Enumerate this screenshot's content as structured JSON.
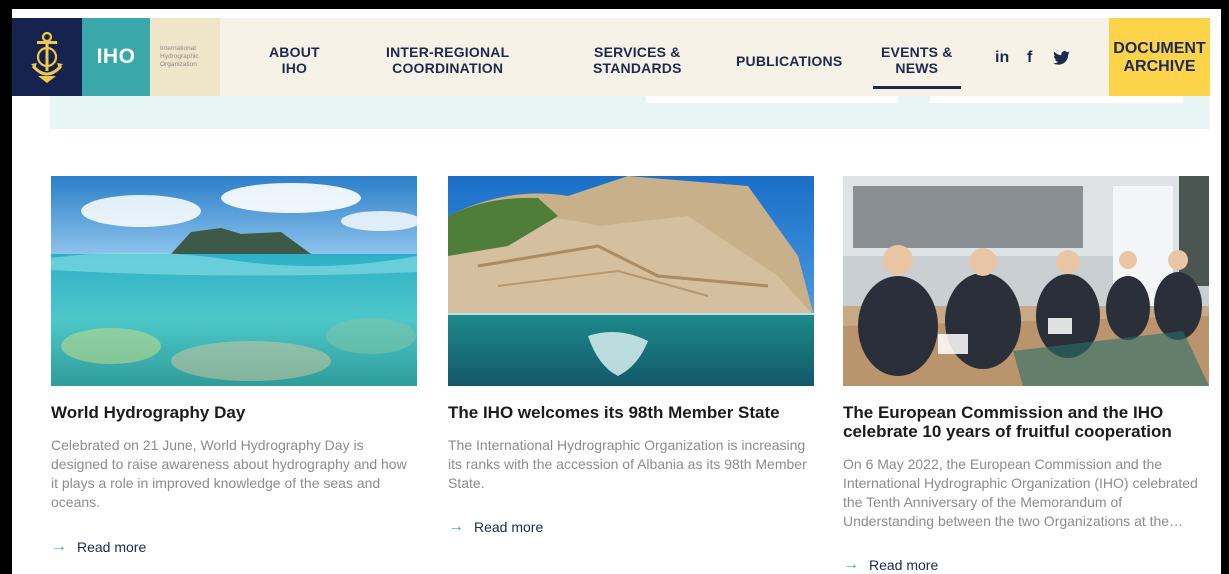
{
  "nav": {
    "logo_short": "IHO",
    "logo_full": "International Hydrographic Organization",
    "items": [
      {
        "line1": "ABOUT",
        "line2": "IHO"
      },
      {
        "line1": "INTER-REGIONAL",
        "line2": "COORDINATION"
      },
      {
        "line1": "SERVICES &",
        "line2": "STANDARDS"
      },
      {
        "line1": "PUBLICATIONS",
        "line2": ""
      },
      {
        "line1": "EVENTS &",
        "line2": "NEWS"
      }
    ],
    "social": {
      "linkedin": "in",
      "facebook": "f",
      "twitter": "twitter-icon"
    },
    "archive": {
      "line1": "DOCUMENT",
      "line2": "ARCHIVE"
    },
    "active_item": "EVENTS & NEWS"
  },
  "cards": [
    {
      "image": "ocean-island-split-view",
      "title": "World Hydrography Day",
      "description": "Celebrated on 21 June, World Hydrography Day is designed to raise awareness about hydrography and how it plays a role in improved knowledge of the seas and oceans.",
      "read_more": "Read more"
    },
    {
      "image": "albania-coastal-cliff",
      "title": "The IHO welcomes its 98th Member State",
      "description": "The International Hydrographic Organization is increasing its ranks with the accession of Albania as its 98th Member State.",
      "read_more": "Read more"
    },
    {
      "image": "conference-panel-photo",
      "title": "The European Commission and the IHO celebrate 10 years of fruitful cooperation",
      "description": "On 6 May 2022, the European Commission and the International Hydrographic Organization (IHO) celebrated the Tenth Anniversary of the Memorandum of Understanding between the two Organizations at the…",
      "read_more": "Read more"
    }
  ],
  "colors": {
    "navy": "#16234e",
    "teal": "#3aa7aa",
    "yellow": "#fdd34a",
    "cream": "#f6f2e7"
  }
}
